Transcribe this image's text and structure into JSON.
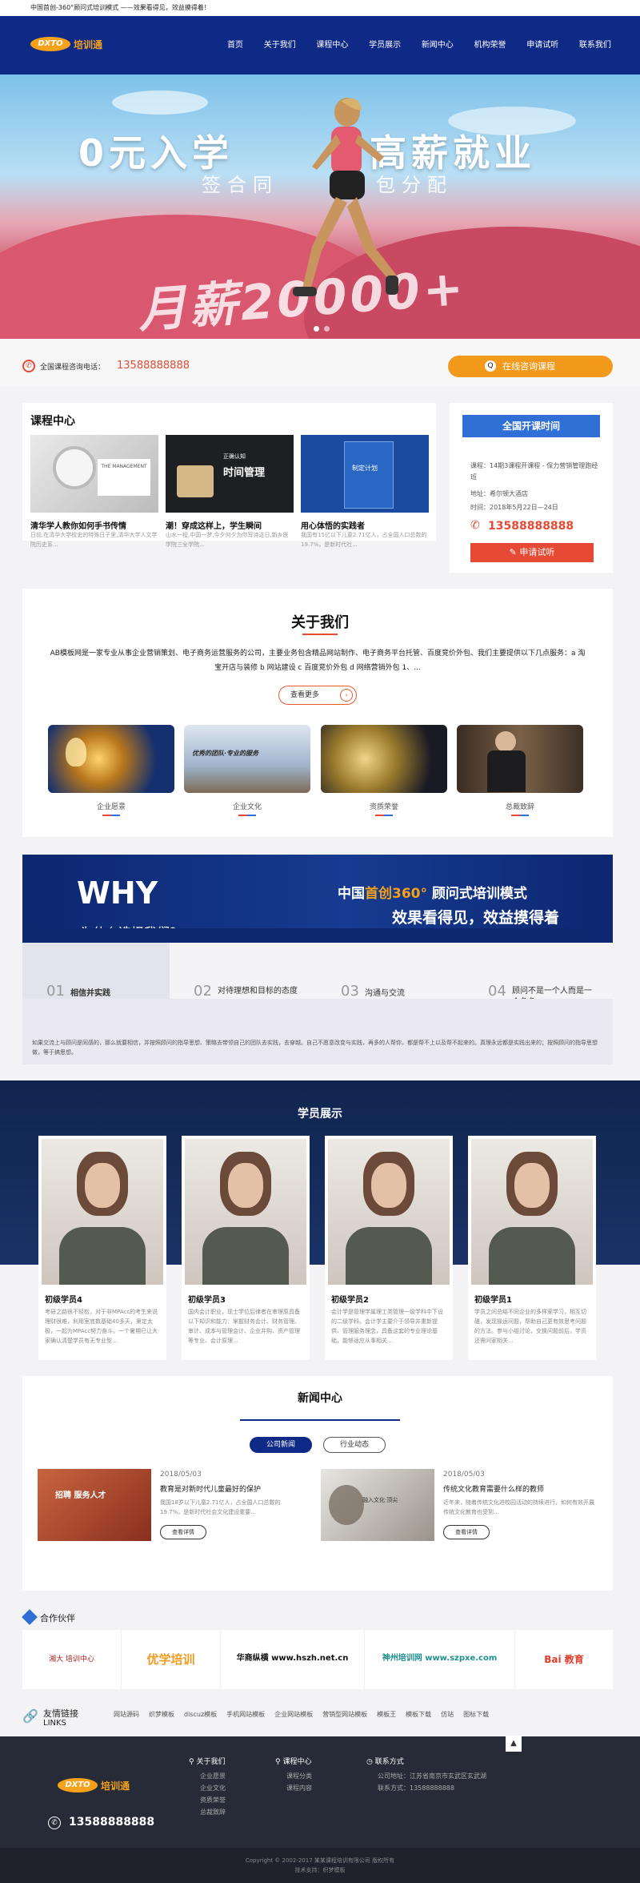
{
  "topbar": {
    "text": "中国首创-360°顾问式培训模式 ——效果看得见，效益摸得着！"
  },
  "logo": {
    "en": "DXTO",
    "cn": "培训通"
  },
  "nav": [
    "首页",
    "关于我们",
    "课程中心",
    "学员展示",
    "新闻中心",
    "机构荣誉",
    "申请试听",
    "联系我们"
  ],
  "banner": {
    "line1a": "0元入学",
    "line1b": "高薪就业",
    "line2a": "签合同",
    "line2b": "包分配",
    "salary": "月薪20000+"
  },
  "hotline": {
    "label": "全国课程咨询电话：",
    "phone": "13588888888",
    "consult": "在线咨询课程"
  },
  "courses": {
    "title": "课程中心",
    "items": [
      {
        "title": "清华学人教你如何手书传情",
        "desc": "日前,在清华大学校史的特殊日子里,清华大学人文学院历史系..."
      },
      {
        "title": "潮！穿成这样上，学生瞬间",
        "desc": "山水一程,中国一梦,今夕何夕为你写诗达日,新乡医学院三全学院..."
      },
      {
        "title": "用心体悟的实践者",
        "desc": "我国有15亿以下儿童2.71亿人，占全国人口总数的19.7%，是新时代社..."
      }
    ],
    "img1_book": "THE MANAGEMENT",
    "img2_text": "时间管理",
    "img2_sub": "正确认知",
    "img3_text": "制定计划"
  },
  "schedule": {
    "title": "全国开课时间",
    "course": "课程：14期3课程开课程 - 保力营销管理跑经班",
    "addr": "地址：希尔顿大酒店",
    "time": "时间：2018年5月22日—24日",
    "phone": "13588888888",
    "apply": "申请试听"
  },
  "about": {
    "title": "关于我们",
    "desc1": "AB模板网是一家专业从事企业营销策划、电子商务运营服务的公司，主要业务包含精品网站制作、电子商务平台托管、百度竞价外包、我们主要提供以下几点服务：a 淘",
    "desc2": "宝开店与装修 b 网站建设 c 百度竞价外包 d 网络营销外包 1、...",
    "more": "查看更多",
    "items": [
      "企业愿景",
      "企业文化",
      "资质荣誉",
      "总裁致辞"
    ],
    "img2_text": "优秀的团队·专业的服务"
  },
  "why": {
    "en": "WHY",
    "cn": "为什么选择我们？",
    "slogan1a": "中国",
    "slogan1b": "首创360°",
    "slogan1c": "顾问式培训模式",
    "slogan2": "效果看得见，效益摸得着",
    "tabs": [
      {
        "num": "01",
        "label": "相信并实践"
      },
      {
        "num": "02",
        "label": "对待理想和目标的态度"
      },
      {
        "num": "03",
        "label": "沟通与交流"
      },
      {
        "num": "04",
        "label": "顾问不是一个人而是一个角色"
      }
    ],
    "body": "如果交流上与顾问是同感的，那么就要相信，并按照顾问的指导思想、策略去带领自己的团队去实践，去穿越。自己不愿意改变与实践，再多的人帮你，都是帮不上以及帮不起来的。真理永远都是实践出来的；按照顾问的指导思想做，等于搞思想。"
  },
  "students": {
    "title": "学员展示",
    "items": [
      {
        "name": "初级学员4",
        "desc": "考研之路很不轻松，对于非MPAcc的考生来说理财很难，利用室底数基础40多天，第定太极，一起为MPAcc努力奋斗。一个暑期已让大家确认清楚学员有无专业型..."
      },
      {
        "name": "初级学员3",
        "desc": "国内会计职业，现士学位后律者在审理原具备以下知识和能力：掌握财务会计、财务管理、审计、成本与管理会计、企业并购、资产管理等专业、会计原理..."
      },
      {
        "name": "初级学员2",
        "desc": "会计学是管理学属理工类管理一级学科中下设的二级学科。会计学主要介于领导并重新提供、管理服务理念，具备这套的专业理论基础，能够适应从事相关..."
      },
      {
        "name": "初级学员1",
        "desc": "学员之间总结不同企业的多样案学习，相互切磋，发现操运问题，帮助自己更有效思考问题的方法。参与小组讨论，交换问题前后，学员还需问家相关..."
      }
    ]
  },
  "news": {
    "title": "新闻中心",
    "tab_active": "公司新闻",
    "tab_other": "行业动态",
    "items": [
      {
        "date": "2018/05/03",
        "title": "教育是对新时代儿童最好的保护",
        "desc": "我国18岁以下儿童2.71亿人，占全国人口总数的19.7%，是新时代社会文化建设重要...",
        "more": "查看详情",
        "img_text": "招聘 服务人才"
      },
      {
        "date": "2018/05/03",
        "title": "传统文化教育需要什么样的教师",
        "desc": "近年来，随着传统文化进校园活动的持续进行，如何有效开展传统文化教育也受到...",
        "more": "查看详情",
        "img_text": "融入文化·顶尖"
      }
    ]
  },
  "partners": {
    "title": "合作伙伴",
    "logos": [
      "湘大 培训中心",
      "优学培训",
      "华商纵横 www.hszh.net.cn",
      "神州培训网 www.szpxe.com",
      "Bai 教育"
    ]
  },
  "links": {
    "title": "友情链接",
    "en": "LINKS",
    "items": [
      "网站源码",
      "织梦模板",
      "discuz模板",
      "手机网站模板",
      "企业网站模板",
      "营销型网站模板",
      "模板王",
      "模板下载",
      "仿站",
      "图标下载"
    ]
  },
  "footer": {
    "phone": "13588888888",
    "col1": {
      "title": "关于我们",
      "items": [
        "企业愿景",
        "企业文化",
        "资质荣誉",
        "总裁致辞"
      ]
    },
    "col2": {
      "title": "课程中心",
      "items": [
        "课程分类",
        "课程内容"
      ]
    },
    "col3": {
      "title": "联系方式",
      "items": [
        "公司地址：江苏省南京市玄武区玄武湖",
        "联系方式：13588888888"
      ]
    },
    "copyright": "Copyright © 2002-2017 某某课程培训有限公司 版权所有",
    "tech": "技术支持：织梦模板"
  },
  "colors": {
    "navy": "#0f2a86",
    "orange": "#f5a11a",
    "red": "#e74a34",
    "blue": "#2f6fd6"
  }
}
